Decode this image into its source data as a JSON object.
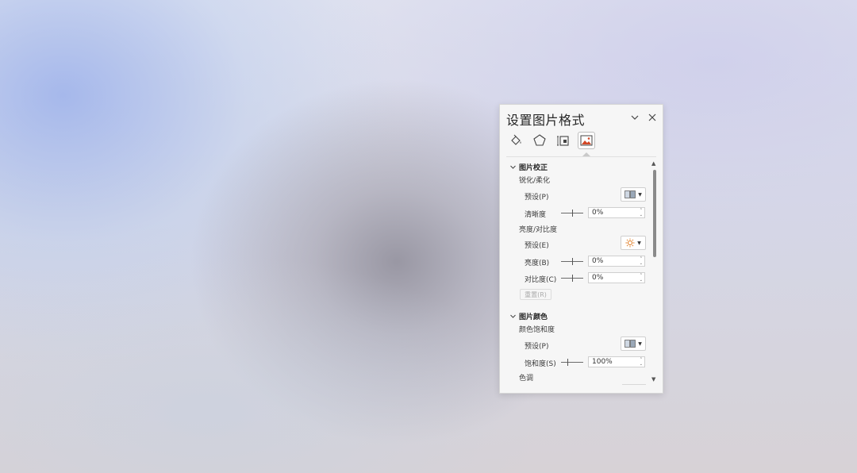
{
  "pane": {
    "title": "设置图片格式",
    "collapse_icon": "chevron-down-icon",
    "close_icon": "close-icon",
    "tabs": [
      {
        "name": "fill-line",
        "icon": "paint-bucket-icon"
      },
      {
        "name": "effects",
        "icon": "pentagon-icon"
      },
      {
        "name": "size-properties",
        "icon": "size-properties-icon"
      },
      {
        "name": "picture",
        "icon": "picture-icon",
        "active": true
      }
    ]
  },
  "correction": {
    "header": "图片校正",
    "sharpen_group": "锐化/柔化",
    "preset_label": "预设(P)",
    "sharpness_label": "清晰度",
    "sharpness_value": "0%",
    "brightness_group": "亮度/对比度",
    "preset2_label": "预设(E)",
    "brightness_label": "亮度(B)",
    "brightness_value": "0%",
    "contrast_label": "对比度(C)",
    "contrast_value": "0%",
    "reset_label": "重置(R)"
  },
  "color": {
    "header": "图片颜色",
    "saturation_group": "颜色饱和度",
    "preset_label": "预设(P)",
    "saturation_label": "饱和度(S)",
    "saturation_value": "100%",
    "tone_group": "色调"
  },
  "colors": {
    "accent_sun": "#e07a1f",
    "picture_red": "#d24726"
  }
}
